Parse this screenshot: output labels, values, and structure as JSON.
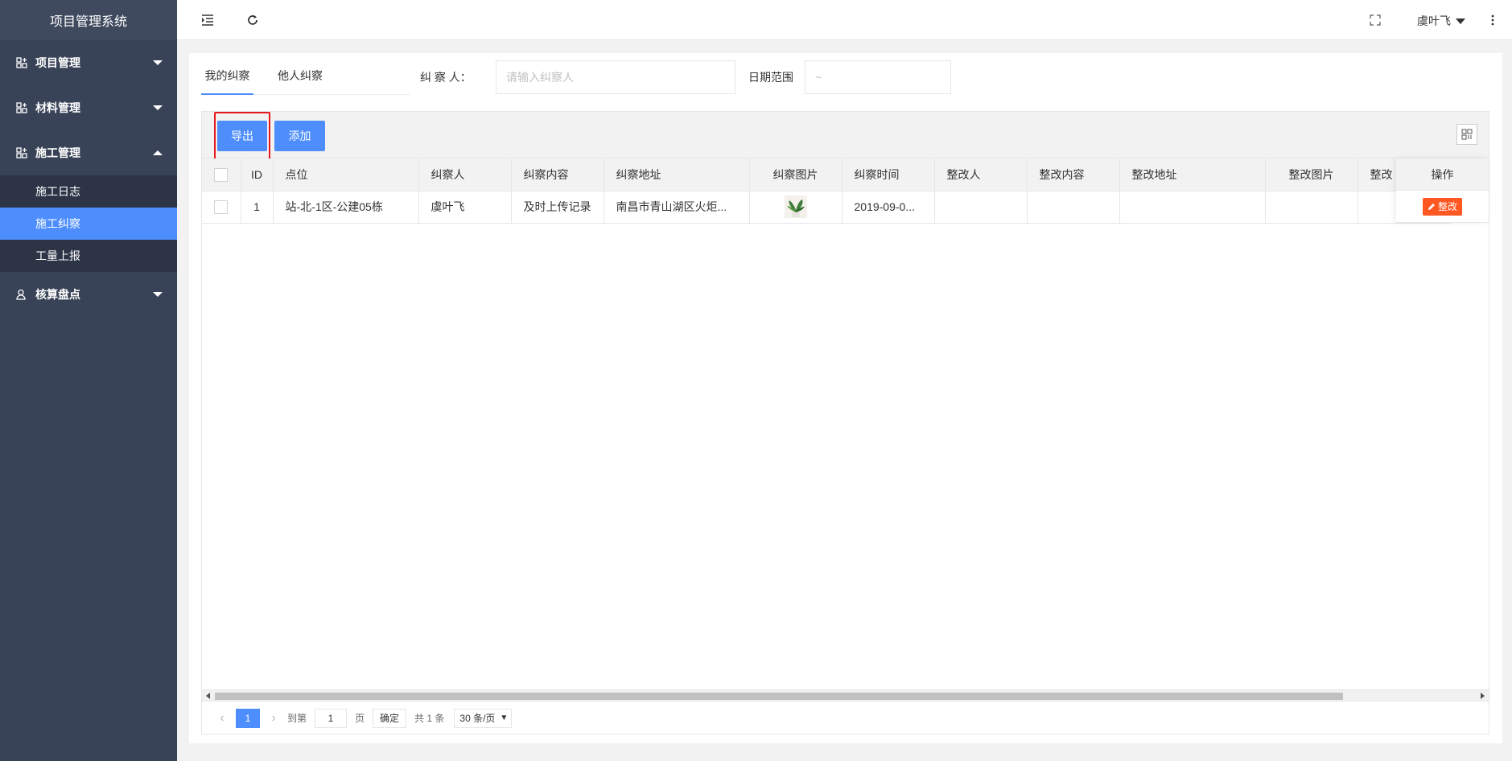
{
  "app": {
    "title": "项目管理系统"
  },
  "sidebar": {
    "items": [
      {
        "label": "项目管理"
      },
      {
        "label": "材料管理"
      },
      {
        "label": "施工管理"
      },
      {
        "label": "核算盘点"
      }
    ],
    "construction_sub": [
      {
        "label": "施工日志"
      },
      {
        "label": "施工纠察"
      },
      {
        "label": "工量上报"
      }
    ]
  },
  "topbar": {
    "user": "虞叶飞"
  },
  "tabs": [
    {
      "label": "我的纠察"
    },
    {
      "label": "他人纠察"
    }
  ],
  "filters": {
    "inspector_label": "纠 察 人：",
    "inspector_placeholder": "请输入纠察人",
    "date_label": "日期范围",
    "date_value": "~"
  },
  "toolbar": {
    "export_label": "导出",
    "add_label": "添加"
  },
  "table": {
    "headers": [
      "ID",
      "点位",
      "纠察人",
      "纠察内容",
      "纠察地址",
      "纠察图片",
      "纠察时间",
      "整改人",
      "整改内容",
      "整改地址",
      "整改图片",
      "整改"
    ],
    "op_header": "操作",
    "rows": [
      {
        "id": "1",
        "point": "站-北-1区-公建05栋",
        "inspector": "虞叶飞",
        "content": "及时上传记录",
        "address": "南昌市青山湖区火炬...",
        "time": "2019-09-0...",
        "fixer": "",
        "fix_content": "",
        "fix_address": "",
        "fix_image": "",
        "fix_extra": "",
        "action": "整改"
      }
    ]
  },
  "pager": {
    "current": "1",
    "goto_label": "到第",
    "goto_value": "1",
    "page_unit": "页",
    "confirm": "确定",
    "total": "共 1 条",
    "page_size": "30 条/页"
  },
  "colors": {
    "sidebar_bg": "#394357",
    "accent": "#4e8efc",
    "danger": "#ff5722",
    "highlight": "#e8171b"
  }
}
